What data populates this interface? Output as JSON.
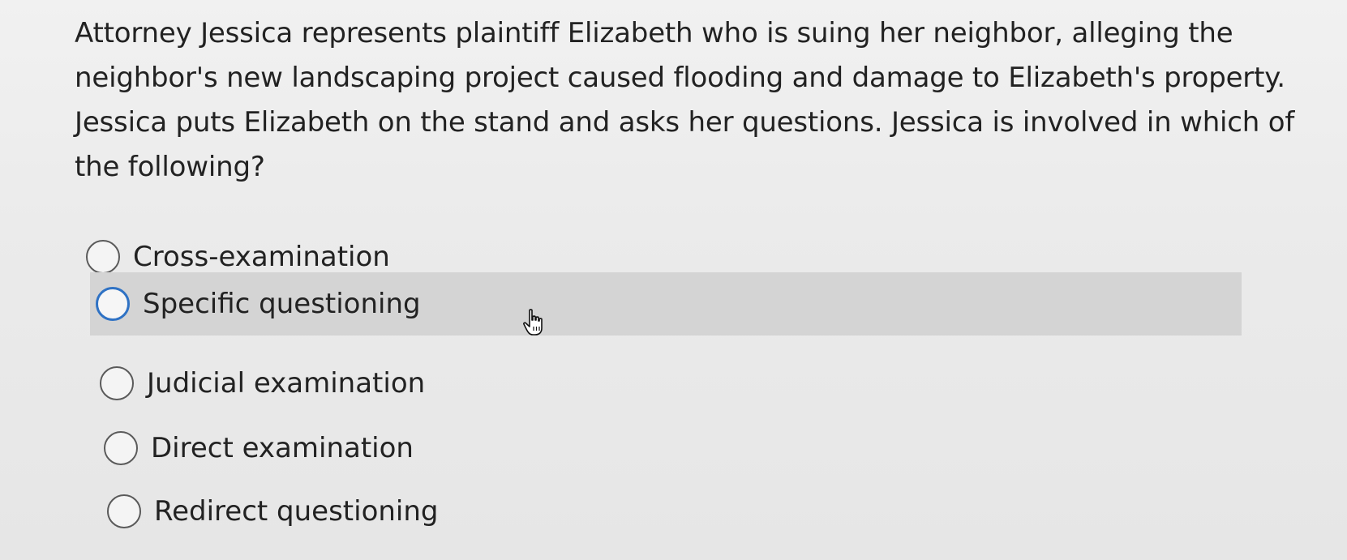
{
  "question": {
    "text": "Attorney Jessica represents plaintiff Elizabeth who is suing her neighbor, alleging the neighbor's new landscaping project caused flooding and damage to Elizabeth's property. Jessica puts Elizabeth on the stand and asks her questions. Jessica is involved in which of the following?"
  },
  "options": [
    {
      "label": "Cross-examination"
    },
    {
      "label": "Specific questioning"
    },
    {
      "label": "Judicial examination"
    },
    {
      "label": "Direct examination"
    },
    {
      "label": "Redirect questioning"
    }
  ],
  "hovered_option": "Specific questioning",
  "icons": {
    "radio": "radio-button-icon",
    "cursor": "hand-pointer-cursor-icon"
  },
  "colors": {
    "hover_background": "#d4d4d4",
    "focus_ring": "#2f72c4"
  }
}
